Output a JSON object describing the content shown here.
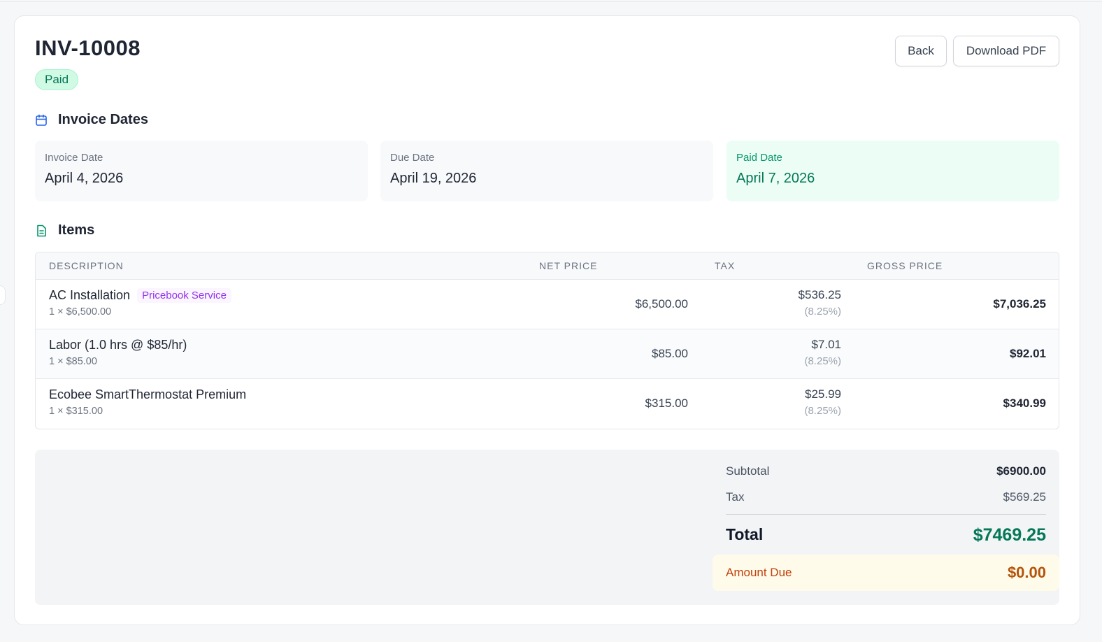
{
  "invoice": {
    "number": "INV-10008",
    "status": "Paid"
  },
  "actions": {
    "back_label": "Back",
    "download_label": "Download PDF"
  },
  "dates_section": {
    "title": "Invoice Dates",
    "icon": "calendar-icon",
    "invoice_date_label": "Invoice Date",
    "invoice_date": "April 4, 2026",
    "due_date_label": "Due Date",
    "due_date": "April 19, 2026",
    "paid_date_label": "Paid Date",
    "paid_date": "April 7, 2026"
  },
  "items_section": {
    "title": "Items",
    "icon": "document-icon",
    "columns": [
      "DESCRIPTION",
      "NET PRICE",
      "TAX",
      "GROSS PRICE"
    ],
    "rows": [
      {
        "name": "AC Installation",
        "tag": "Pricebook Service",
        "qty": "1 × $6,500.00",
        "net": "$6,500.00",
        "tax": "$536.25",
        "tax_rate": "(8.25%)",
        "gross": "$7,036.25"
      },
      {
        "name": "Labor (1.0 hrs @ $85/hr)",
        "tag": "",
        "qty": "1 × $85.00",
        "net": "$85.00",
        "tax": "$7.01",
        "tax_rate": "(8.25%)",
        "gross": "$92.01"
      },
      {
        "name": "Ecobee SmartThermostat Premium",
        "tag": "",
        "qty": "1 × $315.00",
        "net": "$315.00",
        "tax": "$25.99",
        "tax_rate": "(8.25%)",
        "gross": "$340.99"
      }
    ]
  },
  "summary": {
    "subtotal_label": "Subtotal",
    "subtotal": "$6900.00",
    "tax_label": "Tax",
    "tax": "$569.25",
    "total_label": "Total",
    "total": "$7469.25",
    "amount_due_label": "Amount Due",
    "amount_due": "$0.00"
  },
  "colors": {
    "paid_green": "#047857",
    "due_orange": "#c2410c",
    "tag_purple": "#9333ea"
  }
}
